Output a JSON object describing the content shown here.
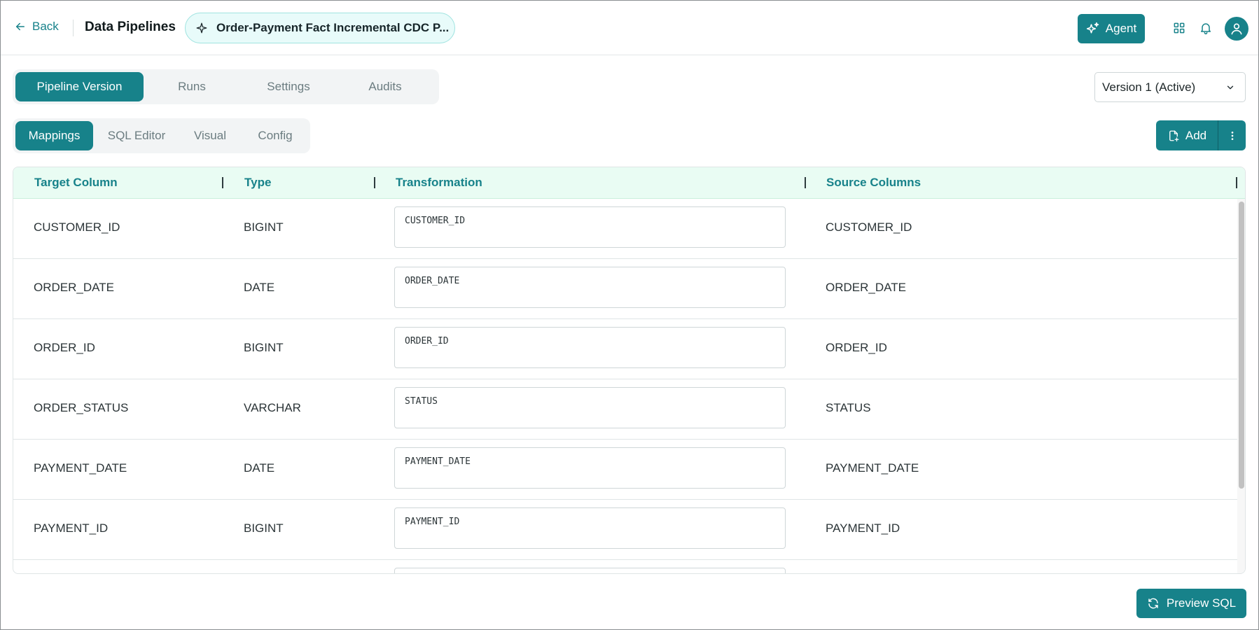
{
  "header": {
    "back_label": "Back",
    "app_title": "Data Pipelines",
    "pipeline_name": "Order-Payment Fact Incremental CDC P...",
    "agent_label": "Agent"
  },
  "primary_tabs": [
    "Pipeline Version",
    "Runs",
    "Settings",
    "Audits"
  ],
  "primary_active": "Pipeline Version",
  "version_select": {
    "value": "Version 1 (Active)"
  },
  "sub_tabs": [
    "Mappings",
    "SQL Editor",
    "Visual",
    "Config"
  ],
  "sub_active": "Mappings",
  "add_label": "Add",
  "table": {
    "columns": [
      "Target Column",
      "Type",
      "Transformation",
      "Source Columns"
    ],
    "rows": [
      {
        "target": "CUSTOMER_ID",
        "type": "BIGINT",
        "transformation": "CUSTOMER_ID",
        "source": "CUSTOMER_ID"
      },
      {
        "target": "ORDER_DATE",
        "type": "DATE",
        "transformation": "ORDER_DATE",
        "source": "ORDER_DATE"
      },
      {
        "target": "ORDER_ID",
        "type": "BIGINT",
        "transformation": "ORDER_ID",
        "source": "ORDER_ID"
      },
      {
        "target": "ORDER_STATUS",
        "type": "VARCHAR",
        "transformation": "STATUS",
        "source": "STATUS"
      },
      {
        "target": "PAYMENT_DATE",
        "type": "DATE",
        "transformation": "PAYMENT_DATE",
        "source": "PAYMENT_DATE"
      },
      {
        "target": "PAYMENT_ID",
        "type": "BIGINT",
        "transformation": "PAYMENT_ID",
        "source": "PAYMENT_ID"
      },
      {
        "target": "",
        "type": "",
        "transformation": "",
        "source": ""
      }
    ]
  },
  "preview_label": "Preview SQL",
  "colors": {
    "accent": "#17828a",
    "header_bg": "#e9fcf3",
    "chip_bg": "#e8fbfa"
  }
}
